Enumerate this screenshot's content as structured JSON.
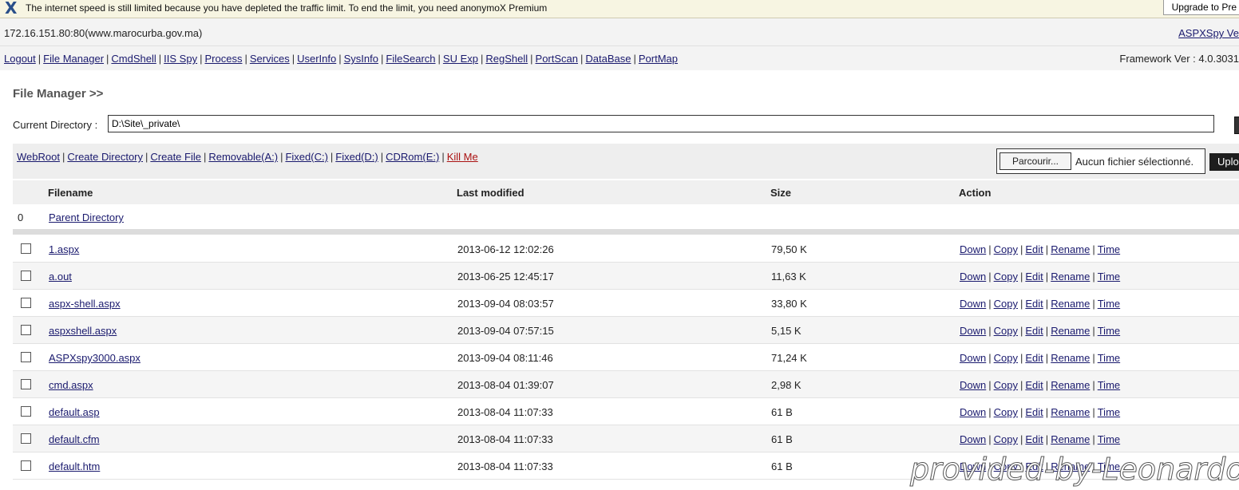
{
  "notification": {
    "message": "The internet speed is still limited because you have depleted the traffic limit. To end the limit, you need anonymoX Premium",
    "button": "Upgrade to Pre"
  },
  "host": {
    "address": "172.16.151.80:80(www.marocurba.gov.ma)",
    "version_link": "ASPXSpy Ve"
  },
  "nav": {
    "links": [
      "Logout",
      "File Manager",
      "CmdShell",
      "IIS Spy",
      "Process",
      "Services",
      "UserInfo",
      "SysInfo",
      "FileSearch",
      "SU Exp",
      "RegShell",
      "PortScan",
      "DataBase",
      "PortMap"
    ],
    "framework": "Framework Ver : 4.0.3031"
  },
  "page_title": "File Manager >>",
  "current_directory": {
    "label": "Current Directory :",
    "value": "D:\\Site\\_private\\"
  },
  "drives": {
    "links": [
      "WebRoot",
      "Create Directory",
      "Create File",
      "Removable(A:)",
      "Fixed(C:)",
      "Fixed(D:)",
      "CDRom(E:)"
    ],
    "kill": "Kill Me"
  },
  "upload": {
    "browse": "Parcourir...",
    "no_file": "Aucun fichier sélectionné.",
    "button": "Uplo"
  },
  "table": {
    "headers": {
      "filename": "Filename",
      "modified": "Last modified",
      "size": "Size",
      "action": "Action"
    },
    "parent": {
      "index": "0",
      "label": "Parent Directory"
    },
    "actions": [
      "Down",
      "Copy",
      "Edit",
      "Rename",
      "Time"
    ],
    "rows": [
      {
        "name": "1.aspx",
        "modified": "2013-06-12 12:02:26",
        "size": "79,50 K"
      },
      {
        "name": "a.out",
        "modified": "2013-06-25 12:45:17",
        "size": "11,63 K"
      },
      {
        "name": "aspx-shell.aspx",
        "modified": "2013-09-04 08:03:57",
        "size": "33,80 K"
      },
      {
        "name": "aspxshell.aspx",
        "modified": "2013-09-04 07:57:15",
        "size": "5,15 K"
      },
      {
        "name": "ASPXspy3000.aspx",
        "modified": "2013-09-04 08:11:46",
        "size": "71,24 K"
      },
      {
        "name": "cmd.aspx",
        "modified": "2013-08-04 01:39:07",
        "size": "2,98 K"
      },
      {
        "name": "default.asp",
        "modified": "2013-08-04 11:07:33",
        "size": "61 B"
      },
      {
        "name": "default.cfm",
        "modified": "2013-08-04 11:07:33",
        "size": "61 B"
      },
      {
        "name": "default.htm",
        "modified": "2013-08-04 11:07:33",
        "size": "61 B"
      }
    ]
  },
  "watermark": "provided-by-Leonardo"
}
